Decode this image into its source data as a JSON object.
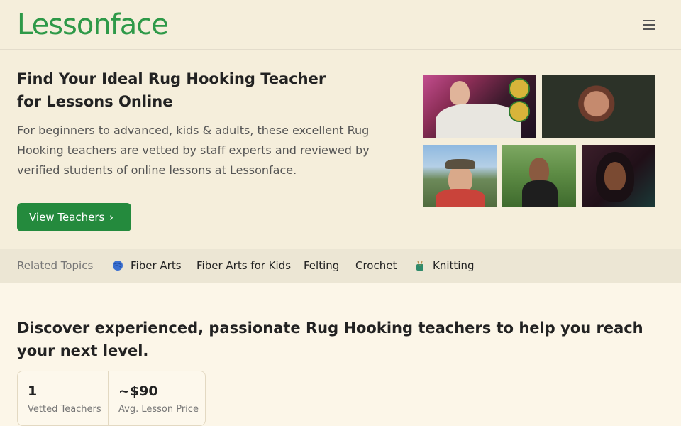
{
  "header": {
    "logo": "Lessonface",
    "menu_icon": "hamburger-menu-icon"
  },
  "hero": {
    "title": "Find Your Ideal Rug Hooking Teacher for Lessons Online",
    "subtitle": "For beginners to advanced, kids & adults, these excellent Rug Hooking teachers are vetted by staff experts and reviewed by verified students of online lessons at Lessonface.",
    "cta_label": "View Teachers",
    "cta_icon": "chevron-right-icon"
  },
  "related": {
    "label": "Related Topics",
    "topics": [
      {
        "label": "Fiber Arts",
        "icon": "yarn-ball-icon"
      },
      {
        "label": "Fiber Arts for Kids"
      },
      {
        "label": "Felting"
      },
      {
        "label": "Crochet"
      },
      {
        "label": "Knitting",
        "icon": "knitting-icon"
      }
    ]
  },
  "main": {
    "heading": "Discover experienced, passionate Rug Hooking teachers to help you reach your next level.",
    "stats": [
      {
        "value": "1",
        "caption": "Vetted Teachers"
      },
      {
        "value": "~$90",
        "caption": "Avg. Lesson Price"
      }
    ]
  },
  "colors": {
    "brand_green": "#2e9948",
    "button_green": "#248a3d",
    "background": "#fcf6e8"
  }
}
